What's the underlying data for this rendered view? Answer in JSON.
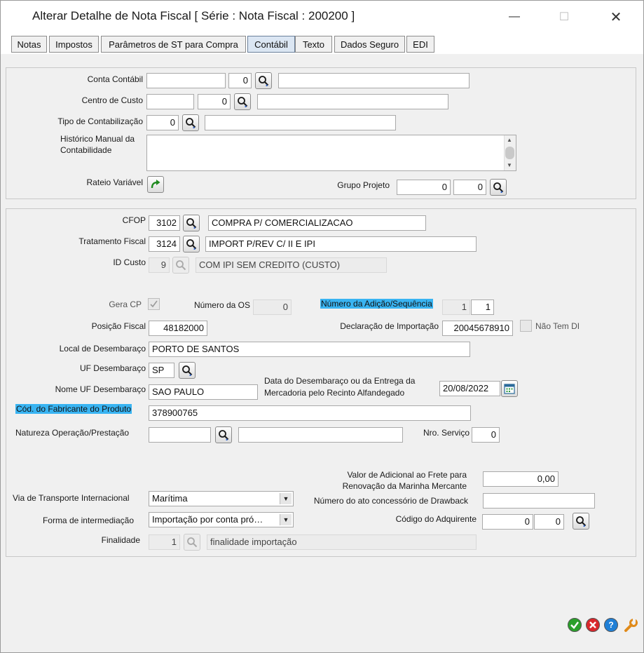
{
  "window": {
    "title": "Alterar Detalhe de Nota Fiscal [ Série :  Nota Fiscal : 200200 ]",
    "minimize": "—",
    "maximize": "☐",
    "close": "✕"
  },
  "tabs": [
    {
      "label": "Notas"
    },
    {
      "label": "Impostos"
    },
    {
      "label": "Parâmetros de ST para Compra"
    },
    {
      "label": "Contábil"
    },
    {
      "label": "Texto"
    },
    {
      "label": "Dados Seguro"
    },
    {
      "label": "EDI"
    }
  ],
  "accounting": {
    "conta_contabil": {
      "label": "Conta Contábil",
      "code": "",
      "number": "0",
      "description": ""
    },
    "centro_custo": {
      "label": "Centro de Custo",
      "code": "",
      "number": "0",
      "description": ""
    },
    "tipo_contabilizacao": {
      "label": "Tipo de Contabilização",
      "number": "0",
      "description": ""
    },
    "historico": {
      "label_line1": "Histórico Manual da",
      "label_line2": "Contabilidade",
      "value": ""
    },
    "rateio": {
      "label": "Rateio Variável"
    },
    "grupo_projeto": {
      "label": "Grupo Projeto",
      "value1": "0",
      "value2": "0"
    }
  },
  "fiscal": {
    "cfop": {
      "label": "CFOP",
      "code": "3102",
      "description": "COMPRA P/ COMERCIALIZACAO"
    },
    "tratamento": {
      "label": "Tratamento Fiscal",
      "code": "3124",
      "description": "IMPORT P/REV C/ II E IPI"
    },
    "id_custo": {
      "label": "ID Custo",
      "code": "9",
      "description": "COM IPI SEM CREDITO (CUSTO)"
    },
    "gera_cp": {
      "label": "Gera CP",
      "checked": true
    },
    "numero_os": {
      "label": "Número da OS",
      "value": "0"
    },
    "adicao": {
      "label": "Número da Adição/Sequência",
      "value1": "1",
      "value2": "1"
    },
    "posicao_fiscal": {
      "label": "Posição Fiscal",
      "value": "48182000"
    },
    "declaracao": {
      "label": "Declaração de Importação",
      "value": "20045678910"
    },
    "nao_tem_di": {
      "label": "Não Tem  DI",
      "checked": false
    },
    "local_desembaraco": {
      "label": "Local de Desembaraço",
      "value": "PORTO DE SANTOS"
    },
    "uf_desembaraco": {
      "label": "UF Desembaraço",
      "value": "SP"
    },
    "nome_uf": {
      "label": "Nome UF Desembaraço",
      "value": "SAO PAULO"
    },
    "data_desembaraco": {
      "label_line1": "Data do Desembaraço ou da Entrega da",
      "label_line2": "Mercadoria pelo Recinto Alfandegado",
      "value": "20/08/2022"
    },
    "cod_fabricante": {
      "label": "Cód. do Fabricante do Produto",
      "value": "378900765"
    },
    "natureza": {
      "label": "Natureza Operação/Prestação",
      "code": "",
      "description": ""
    },
    "nro_servico": {
      "label": "Nro. Serviço",
      "value": "0"
    },
    "frete_adicional": {
      "label_line1": "Valor de Adicional ao Frete para",
      "label_line2": "Renovação da Marinha Mercante",
      "value": "0,00"
    },
    "via_transporte": {
      "label": "Via de Transporte Internacional",
      "value": "Marítima"
    },
    "drawback": {
      "label": "Número do ato concessório de Drawback",
      "value": ""
    },
    "forma_intermediacao": {
      "label": "Forma de intermediação",
      "value": "Importação por conta pró…"
    },
    "adquirente": {
      "label": "Código do Adquirente",
      "value1": "0",
      "value2": "0"
    },
    "finalidade": {
      "label": "Finalidade",
      "code": "1",
      "description": "finalidade importação"
    }
  },
  "footer": {
    "ok_icon": "check-icon",
    "cancel_icon": "x-icon",
    "help_icon": "question-icon",
    "tools_icon": "wrench-icon",
    "help_glyph": "?",
    "colors": {
      "ok": "#2aa02a",
      "cancel": "#d9262b",
      "help": "#1f7fd6",
      "tools": "#e08a1a",
      "highlight": "#39b4f2"
    }
  }
}
